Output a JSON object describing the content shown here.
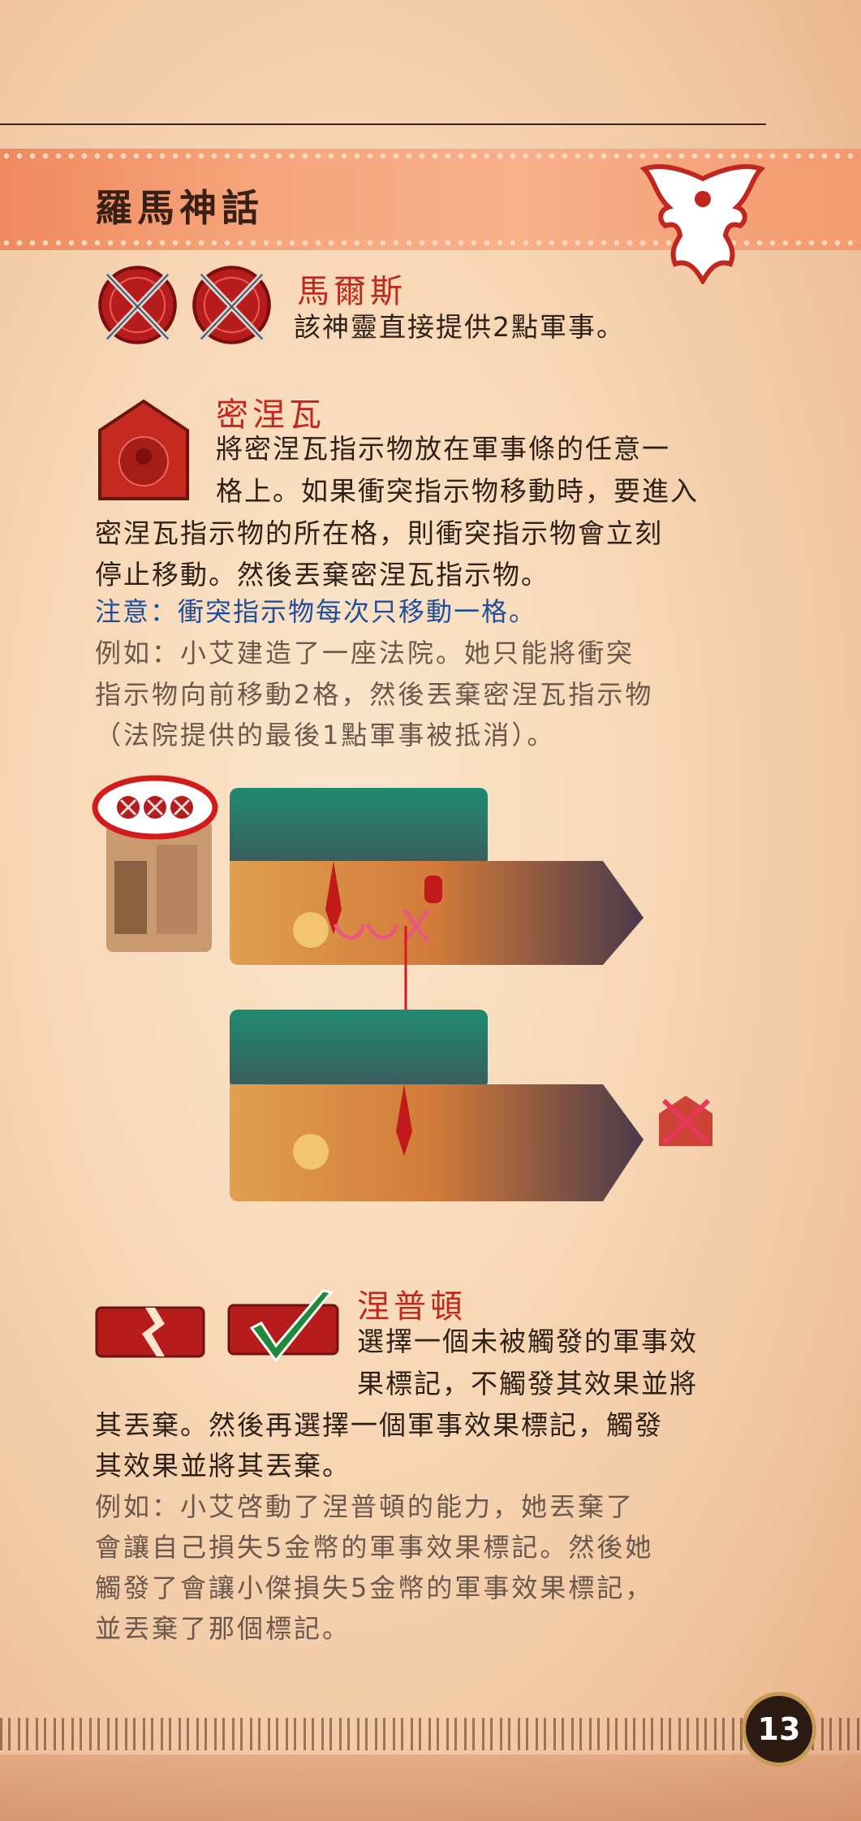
{
  "page": {
    "title": "羅馬神話",
    "page_number": "13"
  },
  "mars": {
    "name": "馬爾斯",
    "text": "該神靈直接提供2點軍事。"
  },
  "minerva": {
    "name": "密涅瓦",
    "text_line1": "將密涅瓦指示物放在軍事條的任意一",
    "text_line2": "格上。如果衝突指示物移動時，要進入",
    "text_line3": "密涅瓦指示物的所在格，則衝突指示物會立刻",
    "text_line4": "停止移動。然後丟棄密涅瓦指示物。",
    "note": "注意：衝突指示物每次只移動一格。",
    "example_line1": "例如：小艾建造了一座法院。她只能將衝突",
    "example_line2": "指示物向前移動2格，然後丟棄密涅瓦指示物",
    "example_line3": "（法院提供的最後1點軍事被抵消）。"
  },
  "neptune": {
    "name": "涅普頓",
    "text_line1": "選擇一個未被觸發的軍事效",
    "text_line2": "果標記，不觸發其效果並將",
    "text_line3": "其丟棄。然後再選擇一個軍事效果標記，觸發",
    "text_line4": "其效果並將其丟棄。",
    "example_line1": "例如：小艾啓動了涅普頓的能力，她丟棄了",
    "example_line2": "會讓自己損失5金幣的軍事效果標記。然後她",
    "example_line3": "觸發了會讓小傑損失5金幣的軍事效果標記，",
    "example_line4": "並丟棄了那個標記。"
  },
  "colors": {
    "heading_red": "#c0271f",
    "note_blue": "#1f4e9c",
    "banner_orange": "#f49a6f"
  },
  "icons": [
    "eagle-emblem-icon",
    "crossed-swords-shield-icon",
    "minerva-token-icon",
    "military-track-scene",
    "broken-token-icon",
    "checkmark-token-icon"
  ]
}
